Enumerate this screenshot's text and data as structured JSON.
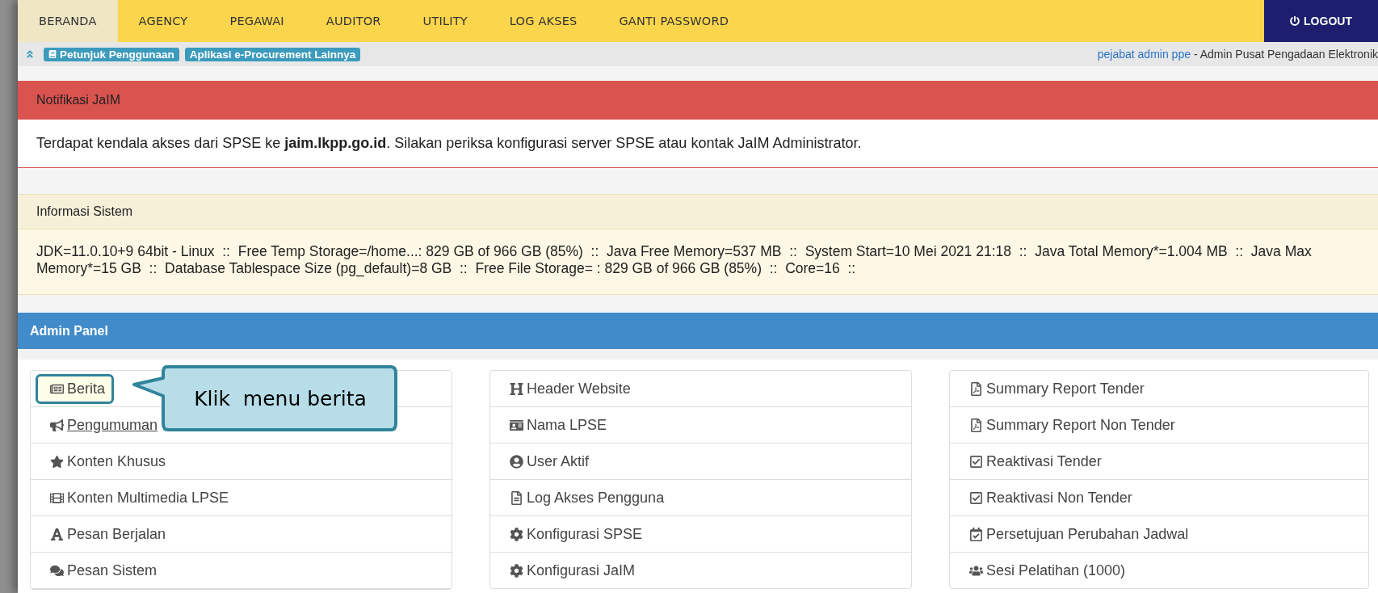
{
  "nav": {
    "tabs": [
      {
        "label": "BERANDA",
        "selected": true
      },
      {
        "label": "AGENCY",
        "selected": false
      },
      {
        "label": "PEGAWAI",
        "selected": false
      },
      {
        "label": "AUDITOR",
        "selected": false
      },
      {
        "label": "UTILITY",
        "selected": false
      },
      {
        "label": "LOG AKSES",
        "selected": false
      },
      {
        "label": "GANTI PASSWORD",
        "selected": false
      }
    ],
    "logout": "LOGOUT"
  },
  "subbar": {
    "badges": [
      "Petunjuk Penggunaan",
      "Aplikasi e-Procurement Lainnya"
    ],
    "user_link": "pejabat admin ppe",
    "user_role": "- Admin Pusat Pengadaan Elektronik"
  },
  "notification": {
    "title": "Notifikasi JaIM",
    "message": "Terdapat kendala akses dari SPSE ke **jaim.lkpp.go.id**. Silakan periksa konfigurasi server SPSE atau kontak JaIM Administrator."
  },
  "system_info": {
    "title": "Informasi Sistem",
    "text": "JDK=11.0.10+9 64bit - Linux  ::  Free Temp Storage=/home...: 829 GB of 966 GB (85%)  ::  Java Free Memory=537 MB  ::  System Start=10 Mei 2021 21:18  ::  Java Total Memory*=1.004 MB  ::  Java Max Memory*=15 GB  ::  Database Tablespace Size (pg_default)=8 GB  ::  Free File Storage= : 829 GB of 966 GB (85%)  ::  Core=16  ::"
  },
  "admin_panel": {
    "title": "Admin Panel",
    "columns": [
      [
        {
          "label": "Berita",
          "highlighted": true,
          "hovered": false
        },
        {
          "label": " Pengumuman",
          "highlighted": false,
          "hovered": true
        },
        {
          "label": "Konten Khusus",
          "highlighted": false,
          "hovered": false
        },
        {
          "label": "Konten Multimedia LPSE",
          "highlighted": false,
          "hovered": false
        },
        {
          "label": "Pesan Berjalan",
          "highlighted": false,
          "hovered": false
        },
        {
          "label": "Pesan Sistem",
          "highlighted": false,
          "hovered": false
        }
      ],
      [
        {
          "label": "Header Website",
          "highlighted": false,
          "hovered": false
        },
        {
          "label": "Nama LPSE",
          "highlighted": false,
          "hovered": false
        },
        {
          "label": "User Aktif",
          "highlighted": false,
          "hovered": false
        },
        {
          "label": "Log Akses Pengguna",
          "highlighted": false,
          "hovered": false
        },
        {
          "label": "Konfigurasi SPSE",
          "highlighted": false,
          "hovered": false
        },
        {
          "label": "Konfigurasi JaIM",
          "highlighted": false,
          "hovered": false
        }
      ],
      [
        {
          "label": "Summary Report Tender",
          "highlighted": false,
          "hovered": false
        },
        {
          "label": "Summary Report Non Tender",
          "highlighted": false,
          "hovered": false
        },
        {
          "label": "Reaktivasi Tender",
          "highlighted": false,
          "hovered": false
        },
        {
          "label": "Reaktivasi Non Tender",
          "highlighted": false,
          "hovered": false
        },
        {
          "label": "Persetujuan Perubahan Jadwal",
          "highlighted": false,
          "hovered": false
        },
        {
          "label": "Sesi Pelatihan (1000)",
          "highlighted": false,
          "hovered": false
        }
      ]
    ]
  },
  "callout": {
    "text": "Klik  menu berita"
  }
}
